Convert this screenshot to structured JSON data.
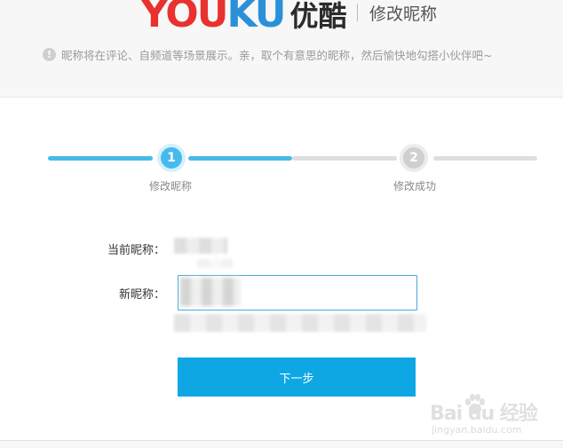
{
  "header": {
    "logo_latin": "YOUKU",
    "logo_cn": "优酷",
    "page_title": "修改昵称",
    "tip": "昵称将在评论、自频道等场景展示。亲，取个有意思的昵称，然后愉快地勾搭小伙伴吧~",
    "tip_icon": "!"
  },
  "steps": [
    {
      "number": "1",
      "label": "修改昵称",
      "state": "active"
    },
    {
      "number": "2",
      "label": "修改成功",
      "state": "pending"
    }
  ],
  "progress": 0.5,
  "form": {
    "current_label": "当前昵称：",
    "new_label": "新昵称：",
    "next_button": "下一步"
  },
  "watermark": {
    "main": "Bai du 经验",
    "sub": "jingyan.baidu.com"
  },
  "colors": {
    "accent": "#0fa7e3",
    "step_active": "#46bbeb",
    "step_inactive": "#cfcfcf",
    "logo_red": "#e9312f",
    "logo_blue": "#2a91d8"
  }
}
